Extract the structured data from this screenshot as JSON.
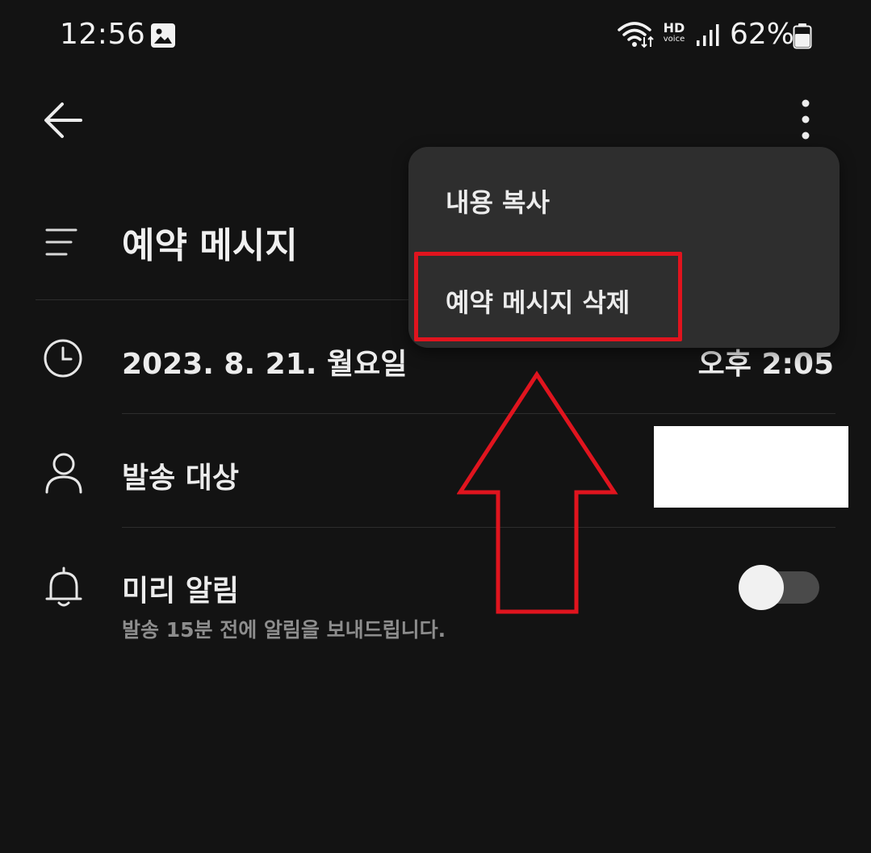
{
  "status_bar": {
    "time": "12:56",
    "hd_top": "HD",
    "hd_bottom": "voice",
    "battery_percent": "62%",
    "icons": [
      "gallery-icon",
      "wifi-icon",
      "hd-voice-icon",
      "signal-icon",
      "battery-icon"
    ]
  },
  "header": {
    "back_icon": "arrow-left-icon",
    "more_icon": "more-vertical-icon"
  },
  "title": {
    "icon": "lines-icon",
    "text": "예약 메시지"
  },
  "schedule": {
    "icon": "clock-icon",
    "date": "2023. 8. 21. 월요일",
    "time": "오후 2:05"
  },
  "recipient": {
    "icon": "person-icon",
    "label": "발송 대상"
  },
  "reminder": {
    "icon": "bell-icon",
    "label": "미리 알림",
    "description": "발송 15분 전에 알림을 보내드립니다.",
    "enabled": false
  },
  "menu": {
    "items": [
      {
        "label": "내용 복사"
      },
      {
        "label": "예약 메시지 삭제"
      }
    ]
  },
  "annotation": {
    "color": "#e0141e"
  }
}
